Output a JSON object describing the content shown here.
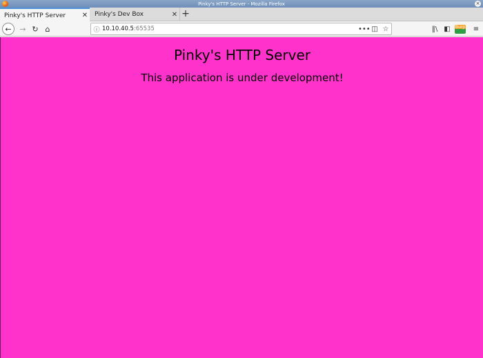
{
  "window": {
    "title": "Pinky's HTTP Server - Mozilla Firefox"
  },
  "tabs": [
    {
      "label": "Pinky's HTTP Server",
      "active": true
    },
    {
      "label": "Pinky's Dev Box",
      "active": false
    }
  ],
  "toolbar": {
    "url_host": "10.10.40.5",
    "url_port": ":65535",
    "new_tab_symbol": "+",
    "burp_label": "Burp"
  },
  "icons": [
    "back-icon",
    "forward-icon",
    "reload-icon",
    "home-icon",
    "info-icon",
    "more-actions-icon",
    "pocket-icon",
    "bookmark-star-icon",
    "library-icon",
    "sidebar-icon",
    "burp-proxy-icon",
    "hamburger-menu-icon",
    "close-icon"
  ],
  "page": {
    "heading": "Pinky's HTTP Server",
    "subheading": "This application is under development!",
    "background_color": "#ff33cc"
  }
}
